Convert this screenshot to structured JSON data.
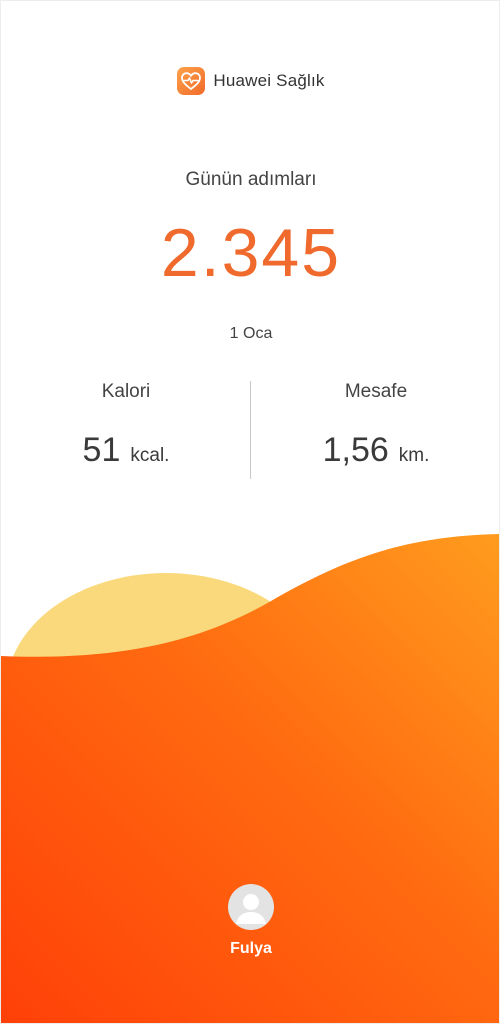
{
  "app": {
    "name": "Huawei Sağlık",
    "logo_icon": "heart-pulse-icon"
  },
  "steps": {
    "label": "Günün adımları",
    "value": "2.345",
    "date": "1 Oca"
  },
  "stats": {
    "calories": {
      "label": "Kalori",
      "value": "51",
      "unit": "kcal."
    },
    "distance": {
      "label": "Mesafe",
      "value": "1,56",
      "unit": "km."
    }
  },
  "profile": {
    "name": "Fulya",
    "avatar_icon": "user-avatar-icon"
  },
  "colors": {
    "accent": "#ef6a2c",
    "sun": "#fad97c",
    "wave_dark": "#ff4a0a",
    "wave_light": "#ff9a1c"
  }
}
